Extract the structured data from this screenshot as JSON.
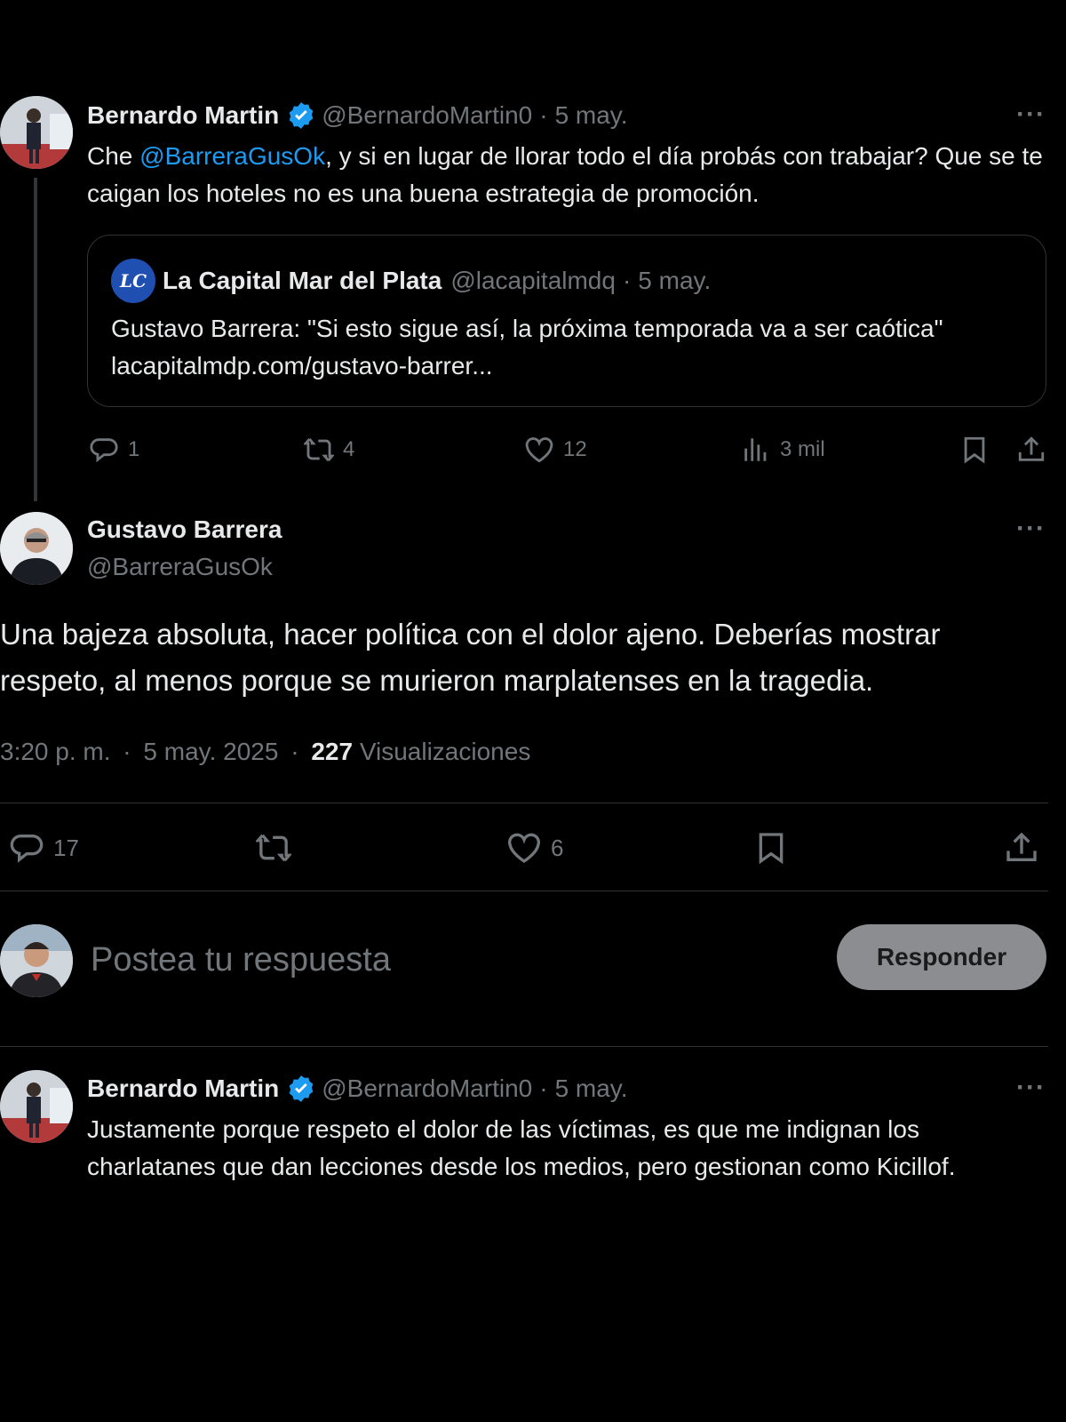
{
  "tweet1": {
    "name": "Bernardo Martin",
    "handle": "@BernardoMartin0",
    "sep": "·",
    "date": "5 may.",
    "more": "···",
    "text_prefix": "Che ",
    "mention": "@BarreraGusOk",
    "text_suffix": ", y si en lugar de llorar todo el día probás con trabajar? Que se te caigan los hoteles  no es una buena estrategia de promoción.",
    "quote": {
      "logo_text": "LC",
      "name": "La Capital Mar del Plata",
      "handle": "@lacapitalmdq",
      "date": "5 may.",
      "text": "Gustavo Barrera: \"Si esto sigue así, la próxima temporada va a ser caótica\" lacapitalmdp.com/gustavo-barrer..."
    },
    "actions": {
      "replies": "1",
      "reposts": "4",
      "likes": "12",
      "views": "3 mil"
    }
  },
  "main": {
    "name": "Gustavo Barrera",
    "handle": "@BarreraGusOk",
    "more": "···",
    "text": "Una bajeza absoluta, hacer política con el dolor ajeno. Deberías mostrar respeto, al menos porque se murieron marplatenses en la tragedia.",
    "time": "3:20 p. m.",
    "sep": "·",
    "date": "5 may. 2025",
    "views_count": "227",
    "views_label": "Visualizaciones",
    "actions": {
      "replies": "17",
      "likes": "6"
    }
  },
  "composer": {
    "placeholder": "Postea tu respuesta",
    "button": "Responder"
  },
  "reply": {
    "name": "Bernardo Martin",
    "handle": "@BernardoMartin0",
    "sep": "·",
    "date": "5 may.",
    "more": "···",
    "text": "Justamente porque respeto el dolor de las víctimas, es que me indignan los charlatanes que dan lecciones desde los medios, pero gestionan como Kicillof."
  },
  "icons": {
    "verified": "verified-badge-icon",
    "reply": "reply-icon",
    "repost": "repost-icon",
    "like": "heart-icon",
    "views": "views-icon",
    "bookmark": "bookmark-icon",
    "share": "share-icon"
  },
  "colors": {
    "background": "#000000",
    "text": "#e7e9ea",
    "secondary": "#71767b",
    "link": "#1d9bf0",
    "button_bg": "#8b8d90"
  }
}
